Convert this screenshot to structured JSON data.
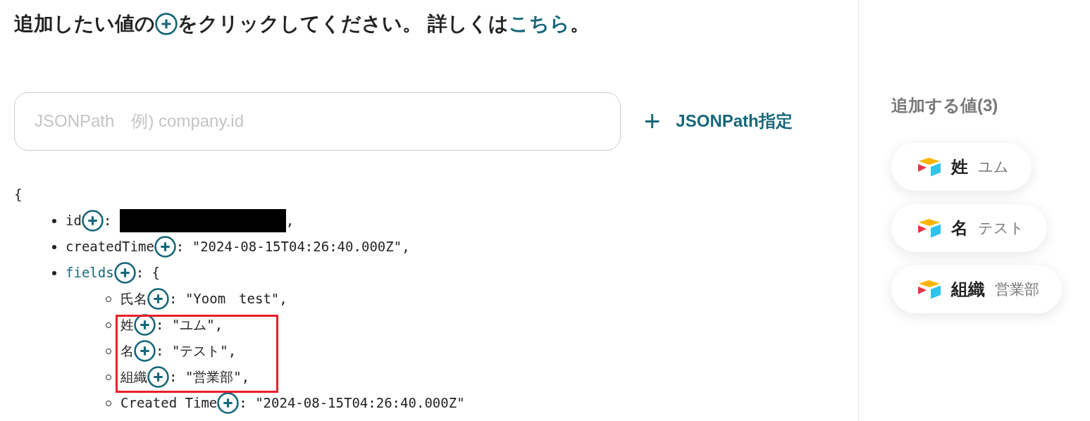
{
  "instruction": {
    "before_icon": "追加したい値の",
    "after_icon": "をクリックしてください。 詳しくは",
    "link": "こちら",
    "end": "。"
  },
  "jsonpath_field": {
    "placeholder": "JSONPath　例) company.id"
  },
  "jsonpath_button": {
    "icon": "+",
    "label": "JSONPath指定"
  },
  "tree": {
    "open": "{",
    "items": [
      {
        "key": "id",
        "object": false,
        "redacted": true,
        "before": ": ",
        "after": ","
      },
      {
        "key": "createdTime",
        "object": false,
        "redacted": false,
        "before": ": \"2024-08-15T04:26:40.000Z\","
      },
      {
        "key": "fields",
        "object": true,
        "redacted": false,
        "before": ": {",
        "children": [
          {
            "key": "氏名",
            "highlighted": false,
            "before": ": \"Yoom　test\","
          },
          {
            "key": "姓",
            "highlighted": true,
            "before": ": \"ユム\","
          },
          {
            "key": "名",
            "highlighted": true,
            "before": ": \"テスト\","
          },
          {
            "key": "組織",
            "highlighted": true,
            "before": ": \"営業部\","
          },
          {
            "key": "Created Time",
            "highlighted": false,
            "before": ": \"2024-08-15T04:26:40.000Z\""
          }
        ]
      }
    ]
  },
  "added_values": {
    "title": "追加する値(3)",
    "items": [
      {
        "name": "姓",
        "value": "ユム"
      },
      {
        "name": "名",
        "value": "テスト"
      },
      {
        "name": "組織",
        "value": "営業部"
      }
    ]
  }
}
